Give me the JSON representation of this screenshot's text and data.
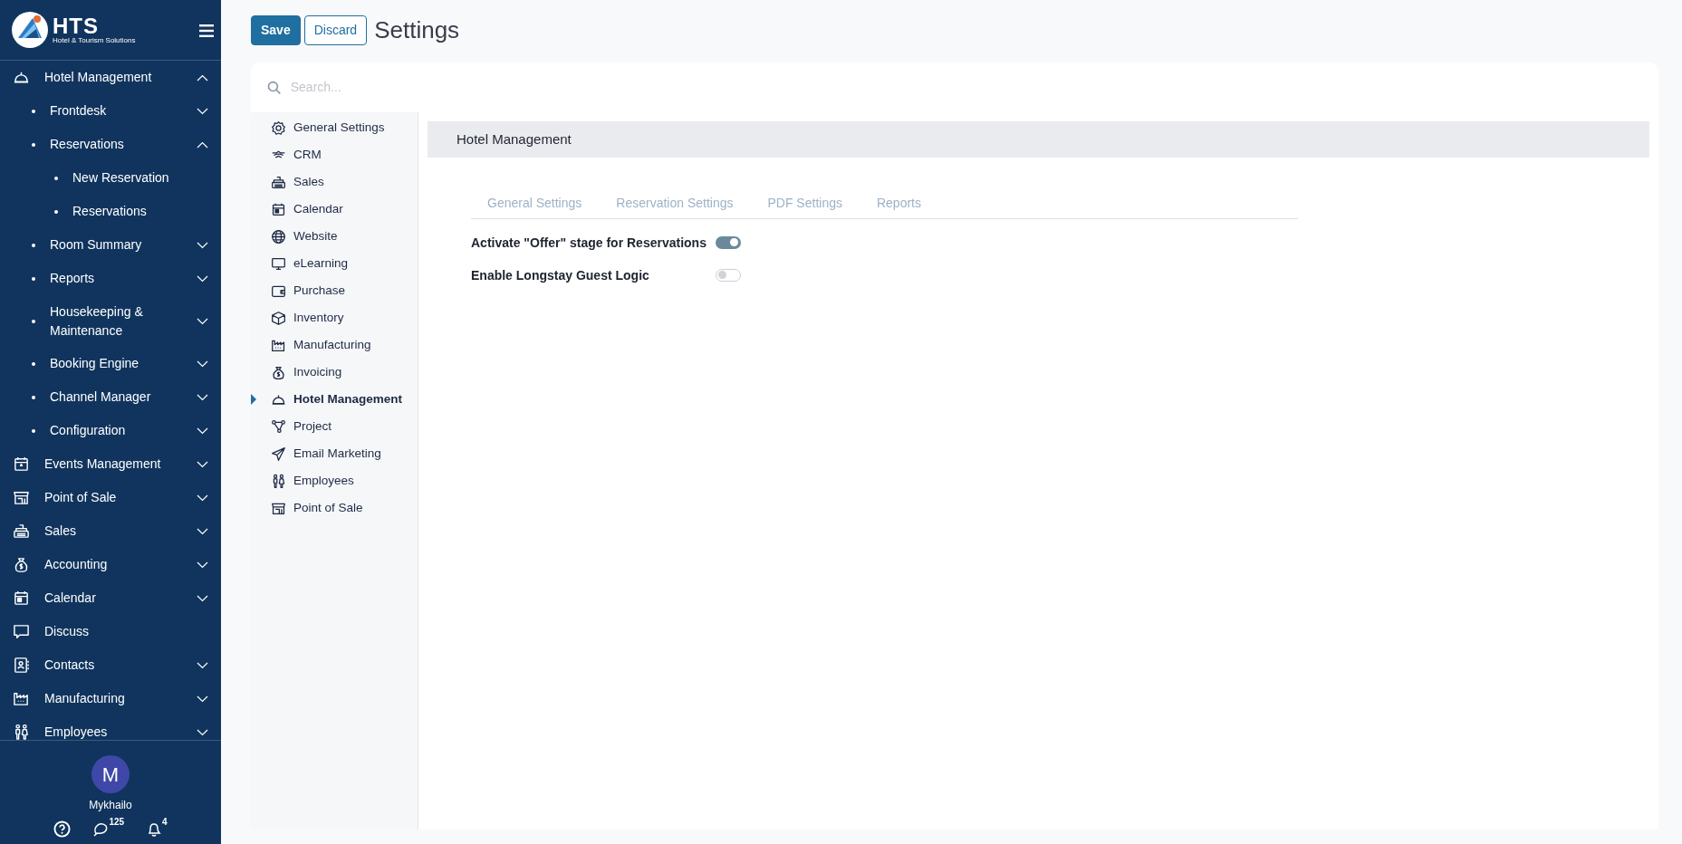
{
  "sidebar": {
    "logo": {
      "name": "HTS",
      "tagline": "Hotel & Tourism Solutions"
    },
    "menu": [
      {
        "label": "Hotel Management",
        "expanded": true,
        "children": [
          {
            "label": "Frontdesk",
            "expanded": false
          },
          {
            "label": "Reservations",
            "expanded": true,
            "children": [
              {
                "label": "New Reservation"
              },
              {
                "label": "Reservations"
              }
            ]
          },
          {
            "label": "Room Summary",
            "expanded": false
          },
          {
            "label": "Reports",
            "expanded": false
          },
          {
            "label": "Housekeeping & Maintenance",
            "expanded": false
          },
          {
            "label": "Booking Engine",
            "expanded": false
          },
          {
            "label": "Channel Manager",
            "expanded": false
          },
          {
            "label": "Configuration",
            "expanded": false
          }
        ]
      },
      {
        "label": "Events Management",
        "expanded": false
      },
      {
        "label": "Point of Sale",
        "expanded": false
      },
      {
        "label": "Sales",
        "expanded": false
      },
      {
        "label": "Accounting",
        "expanded": false
      },
      {
        "label": "Calendar",
        "expanded": false
      },
      {
        "label": "Discuss"
      },
      {
        "label": "Contacts",
        "expanded": false
      },
      {
        "label": "Manufacturing",
        "expanded": false
      },
      {
        "label": "Employees",
        "expanded": false
      }
    ],
    "user": {
      "initial": "M",
      "name": "Mykhailo"
    },
    "footer": {
      "messages": "125",
      "notifications": "4"
    }
  },
  "toolbar": {
    "buttons": [
      "Save",
      "Discard"
    ],
    "title": "Settings"
  },
  "search": {
    "placeholder": "Search..."
  },
  "apps": [
    {
      "label": "General Settings",
      "selected": false
    },
    {
      "label": "CRM",
      "selected": false
    },
    {
      "label": "Sales",
      "selected": false
    },
    {
      "label": "Calendar",
      "selected": false
    },
    {
      "label": "Website",
      "selected": false
    },
    {
      "label": "eLearning",
      "selected": false
    },
    {
      "label": "Purchase",
      "selected": false
    },
    {
      "label": "Inventory",
      "selected": false
    },
    {
      "label": "Manufacturing",
      "selected": false
    },
    {
      "label": "Invoicing",
      "selected": false
    },
    {
      "label": "Hotel Management",
      "selected": true
    },
    {
      "label": "Project",
      "selected": false
    },
    {
      "label": "Email Marketing",
      "selected": false
    },
    {
      "label": "Employees",
      "selected": false
    },
    {
      "label": "Point of Sale",
      "selected": false
    }
  ],
  "section": {
    "title": "Hotel Management",
    "tabs": [
      {
        "label": "General Settings",
        "selected": false
      },
      {
        "label": "Reservation Settings",
        "selected": false
      },
      {
        "label": "PDF Settings",
        "selected": false
      },
      {
        "label": "Reports",
        "selected": false
      }
    ],
    "settings": [
      {
        "label": "Activate \"Offer\" stage for Reservations",
        "on": true
      },
      {
        "label": "Enable Longstay Guest Logic",
        "on": false
      }
    ]
  }
}
